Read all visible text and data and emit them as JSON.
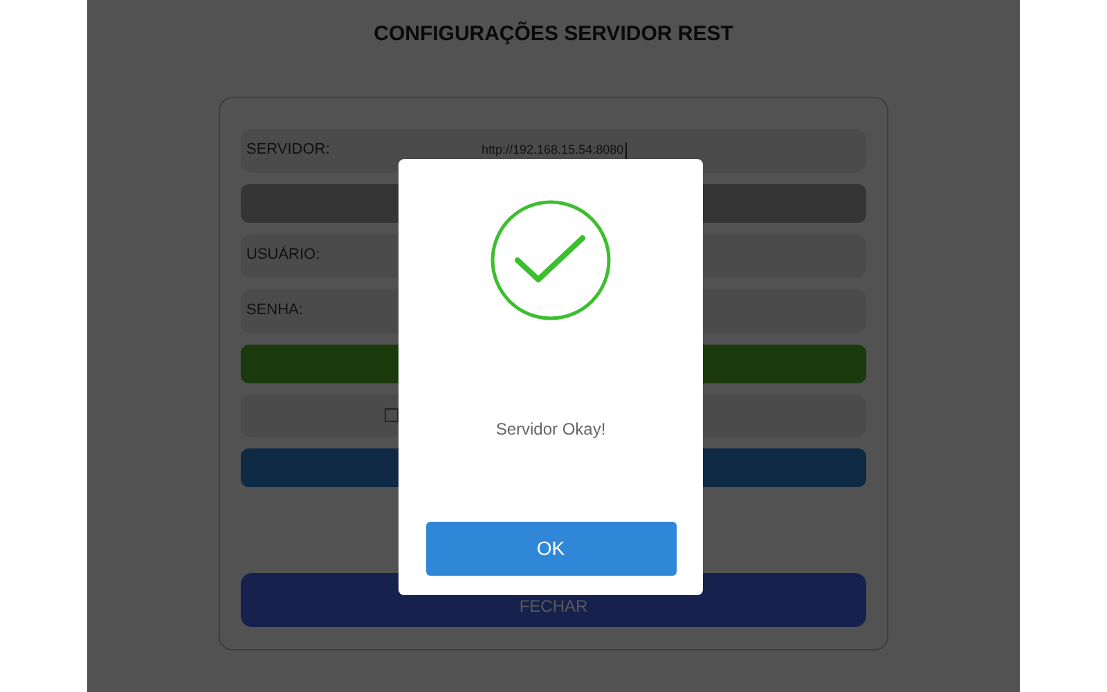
{
  "title": "CONFIGURAÇÕES SERVIDOR REST",
  "fields": [
    {
      "label": "SERVIDOR:",
      "value": "http://192.168.15.54:8080",
      "focused": true
    },
    {
      "label": "USUÁRIO:"
    },
    {
      "label": "SENHA:"
    }
  ],
  "checkbox": {
    "checked": false
  },
  "close_button": "FECHAR",
  "dialog": {
    "message": "Servidor Okay!",
    "button": "OK"
  }
}
